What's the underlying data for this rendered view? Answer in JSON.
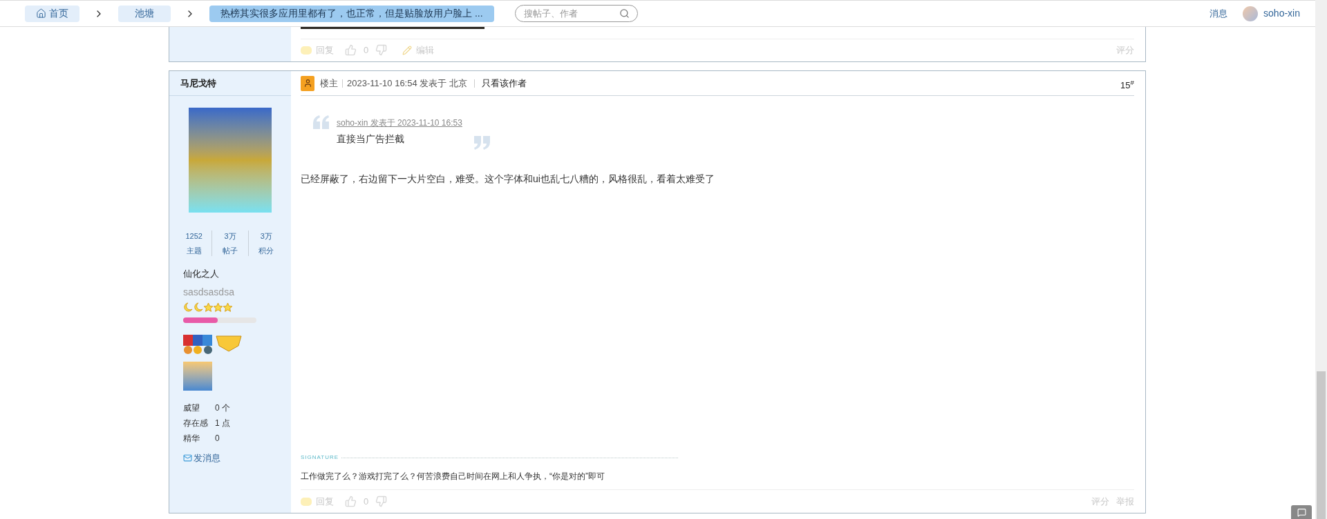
{
  "top_bar": {
    "breadcrumbs": [
      {
        "label": "首页",
        "kind": "home"
      },
      {
        "label": "池塘",
        "kind": "link"
      },
      {
        "label": "热榜其实很多应用里都有了，也正常，但是贴脸放用户脸上 ...",
        "kind": "current"
      }
    ],
    "search": {
      "placeholder": "搜帖子、作者"
    },
    "messages": "消息",
    "user": "soho-xin"
  },
  "previous_post": {
    "reply": "回复",
    "likes": "0",
    "edit": "编辑",
    "rate": "评分"
  },
  "post": {
    "author": {
      "name": "马尼戈特",
      "stats": [
        {
          "value": "1252",
          "label": "主题"
        },
        {
          "value": "3万",
          "label": "帖子"
        },
        {
          "value": "3万",
          "label": "积分"
        }
      ],
      "title": "仙化之人",
      "custom_title": "sasdsasdsa",
      "level": 0.47,
      "details": [
        {
          "label": "威望",
          "value": "0 个"
        },
        {
          "label": "存在感",
          "value": "1 点"
        },
        {
          "label": "精华",
          "value": "0"
        }
      ],
      "message_link": "发消息"
    },
    "header": {
      "role": "楼主",
      "time": "2023-11-10 16:54 发表于 北京",
      "author_only": "只看该作者",
      "floor": "15$^{#}$"
    },
    "quote": {
      "source": "soho-xin 发表于 2023-11-10 16:53",
      "text": "直接当广告拦截"
    },
    "body": "已经屏蔽了，右边留下一大片空白，难受。这个字体和ui也乱七八糟的，风格很乱，看着太难受了",
    "signature": {
      "label": "SIGNATURE",
      "text": "工作做完了么？游戏打完了么？何苦浪费自己时间在网上和人争执，“你是对的”即可"
    },
    "footer": {
      "reply": "回复",
      "likes": "0",
      "rate": "评分",
      "report": "举报"
    }
  }
}
